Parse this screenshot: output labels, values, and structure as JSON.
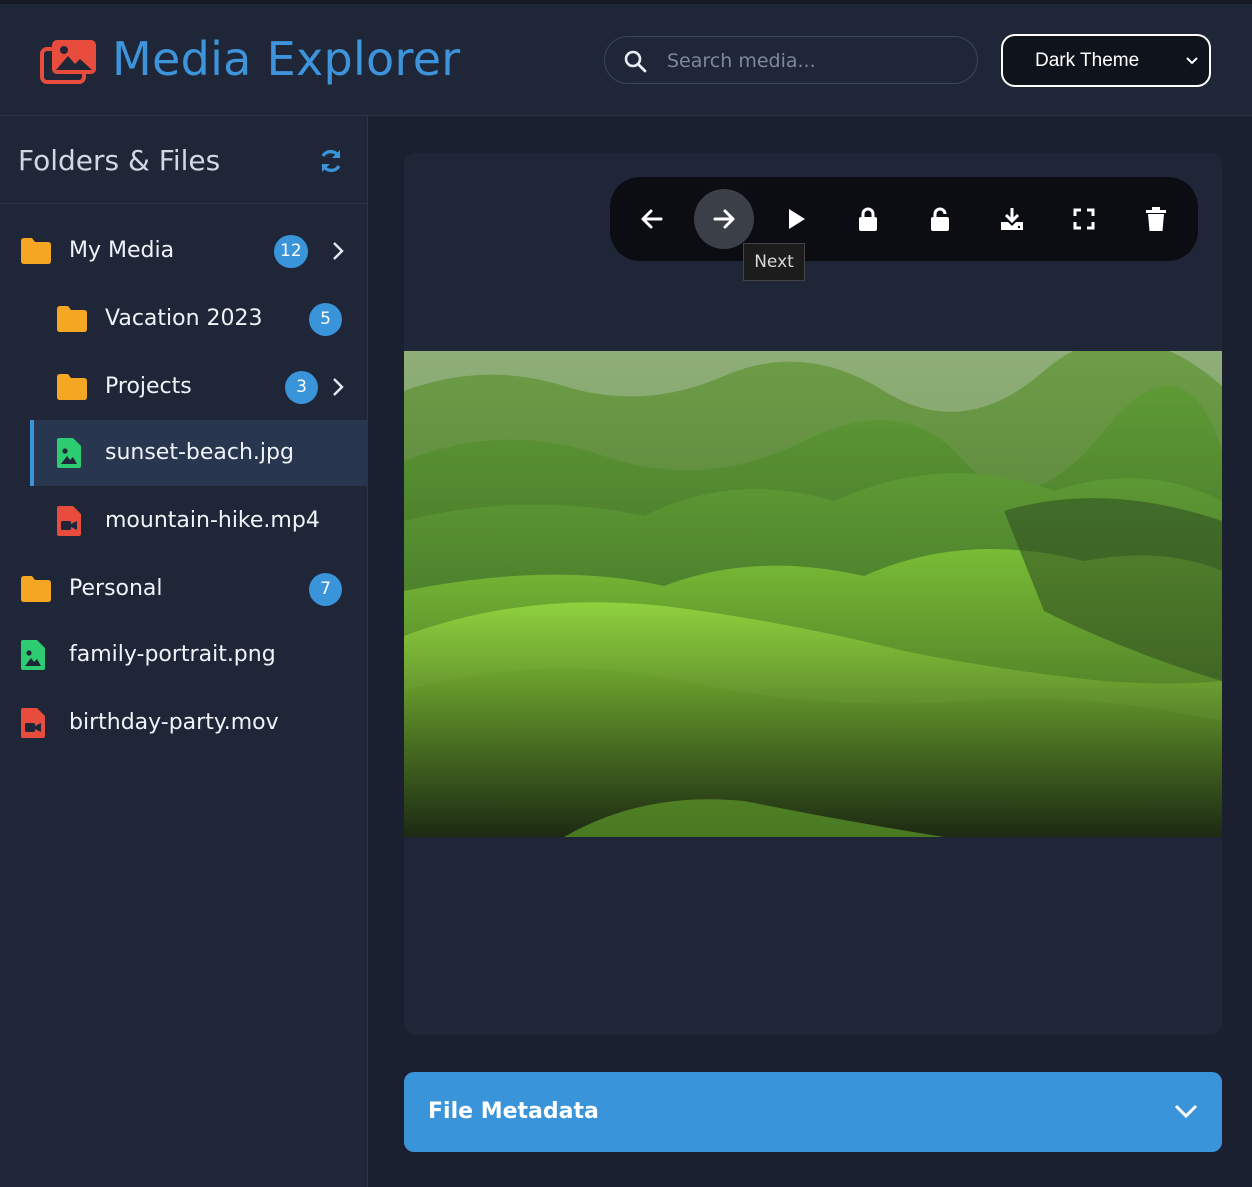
{
  "header": {
    "app_title": "Media Explorer",
    "logo_icon": "images-icon",
    "search": {
      "placeholder": "Search media...",
      "value": ""
    },
    "theme_select": {
      "selected": "Dark Theme"
    }
  },
  "sidebar": {
    "title": "Folders & Files",
    "refresh_icon": "sync-icon",
    "items": [
      {
        "label": "My Media",
        "type": "folder",
        "badge": "12",
        "expandable": true
      },
      {
        "label": "Vacation 2023",
        "type": "folder",
        "badge": "5",
        "expandable": false
      },
      {
        "label": "Projects",
        "type": "folder",
        "badge": "3",
        "expandable": true
      },
      {
        "label": "sunset-beach.jpg",
        "type": "image-file",
        "selected": true
      },
      {
        "label": "mountain-hike.mp4",
        "type": "video-file"
      },
      {
        "label": "Personal",
        "type": "folder",
        "badge": "7",
        "expandable": false
      },
      {
        "label": "family-portrait.png",
        "type": "image-file"
      },
      {
        "label": "birthday-party.mov",
        "type": "video-file"
      }
    ]
  },
  "viewer": {
    "toolbar": [
      "previous",
      "next",
      "play",
      "lock",
      "unlock",
      "download",
      "fullscreen",
      "delete"
    ],
    "tooltip": "Next",
    "image_subject": "green rolling hills landscape"
  },
  "metadata_panel": {
    "title": "File Metadata"
  },
  "colors": {
    "accent": "#3a94d9",
    "folder": "#f5a623",
    "image_file": "#2ecc71",
    "video_file": "#e74c3c",
    "logo": "#e74c3c"
  }
}
